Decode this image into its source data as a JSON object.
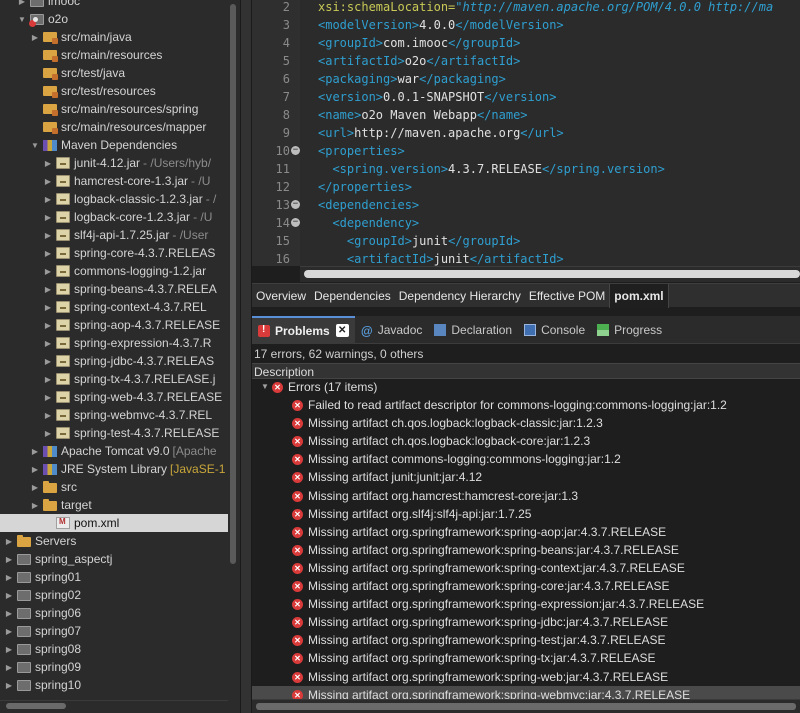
{
  "explorer": {
    "items": [
      {
        "label": "imooc",
        "icon": "project-icon",
        "twisty": "closed"
      },
      {
        "label": "o2o",
        "icon": "project-error-icon",
        "twisty": "open"
      },
      {
        "label": "src/main/java",
        "icon": "source-folder-icon",
        "twisty": "closed"
      },
      {
        "label": "src/main/resources",
        "icon": "source-folder-icon",
        "twisty": ""
      },
      {
        "label": "src/test/java",
        "icon": "source-folder-icon",
        "twisty": ""
      },
      {
        "label": "src/test/resources",
        "icon": "source-folder-icon",
        "twisty": ""
      },
      {
        "label": "src/main/resources/spring",
        "icon": "source-folder-icon",
        "twisty": ""
      },
      {
        "label": "src/main/resources/mapper",
        "icon": "source-folder-icon",
        "twisty": ""
      },
      {
        "label": "Maven Dependencies",
        "icon": "library-icon",
        "twisty": "open"
      },
      {
        "label": "junit-4.12.jar",
        "icon": "jar-icon",
        "twisty": "closed",
        "decoration": "- /Users/hyb/"
      },
      {
        "label": "hamcrest-core-1.3.jar",
        "icon": "jar-icon",
        "twisty": "closed",
        "decoration": "- /U"
      },
      {
        "label": "logback-classic-1.2.3.jar",
        "icon": "jar-icon",
        "twisty": "closed",
        "decoration": "- /"
      },
      {
        "label": "logback-core-1.2.3.jar",
        "icon": "jar-icon",
        "twisty": "closed",
        "decoration": "- /U"
      },
      {
        "label": "slf4j-api-1.7.25.jar",
        "icon": "jar-icon",
        "twisty": "closed",
        "decoration": "- /User"
      },
      {
        "label": "spring-core-4.3.7.RELEAS",
        "icon": "jar-icon",
        "twisty": "closed"
      },
      {
        "label": "commons-logging-1.2.jar",
        "icon": "jar-icon",
        "twisty": "closed"
      },
      {
        "label": "spring-beans-4.3.7.RELEA",
        "icon": "jar-icon",
        "twisty": "closed"
      },
      {
        "label": "spring-context-4.3.7.REL",
        "icon": "jar-icon",
        "twisty": "closed"
      },
      {
        "label": "spring-aop-4.3.7.RELEASE",
        "icon": "jar-icon",
        "twisty": "closed"
      },
      {
        "label": "spring-expression-4.3.7.R",
        "icon": "jar-icon",
        "twisty": "closed"
      },
      {
        "label": "spring-jdbc-4.3.7.RELEAS",
        "icon": "jar-icon",
        "twisty": "closed"
      },
      {
        "label": "spring-tx-4.3.7.RELEASE.j",
        "icon": "jar-icon",
        "twisty": "closed"
      },
      {
        "label": "spring-web-4.3.7.RELEASE",
        "icon": "jar-icon",
        "twisty": "closed"
      },
      {
        "label": "spring-webmvc-4.3.7.REL",
        "icon": "jar-icon",
        "twisty": "closed"
      },
      {
        "label": "spring-test-4.3.7.RELEASE",
        "icon": "jar-icon",
        "twisty": "closed"
      },
      {
        "label": "Apache Tomcat v9.0",
        "icon": "library-icon",
        "twisty": "closed",
        "decoration": "[Apache"
      },
      {
        "label": "JRE System Library",
        "icon": "library-icon",
        "twisty": "closed",
        "decoration": "[JavaSE-1"
      },
      {
        "label": "src",
        "icon": "folder-icon",
        "twisty": "closed"
      },
      {
        "label": "target",
        "icon": "folder-icon",
        "twisty": "closed"
      },
      {
        "label": "pom.xml",
        "icon": "xml-file-icon",
        "twisty": "",
        "selected": true
      },
      {
        "label": "Servers",
        "icon": "servers-folder-icon",
        "twisty": "closed"
      },
      {
        "label": "spring_aspectj",
        "icon": "project-icon",
        "twisty": "closed"
      },
      {
        "label": "spring01",
        "icon": "project-icon",
        "twisty": "closed"
      },
      {
        "label": "spring02",
        "icon": "project-icon",
        "twisty": "closed"
      },
      {
        "label": "spring06",
        "icon": "project-icon",
        "twisty": "closed"
      },
      {
        "label": "spring07",
        "icon": "project-icon",
        "twisty": "closed"
      },
      {
        "label": "spring08",
        "icon": "project-icon",
        "twisty": "closed"
      },
      {
        "label": "spring09",
        "icon": "project-icon",
        "twisty": "closed"
      },
      {
        "label": "spring10",
        "icon": "project-icon",
        "twisty": "closed"
      }
    ]
  },
  "editor": {
    "lines": [
      {
        "n": "2",
        "text": "xsi:schemaLocation=\"http://maven.apache.org/POM/4.0.0 http://ma",
        "fold": ""
      },
      {
        "n": "3",
        "text": "<modelVersion>4.0.0</modelVersion>",
        "fold": ""
      },
      {
        "n": "4",
        "text": "<groupId>com.imooc</groupId>",
        "fold": ""
      },
      {
        "n": "5",
        "text": "<artifactId>o2o</artifactId>",
        "fold": ""
      },
      {
        "n": "6",
        "text": "<packaging>war</packaging>",
        "fold": ""
      },
      {
        "n": "7",
        "text": "<version>0.0.1-SNAPSHOT</version>",
        "fold": ""
      },
      {
        "n": "8",
        "text": "<name>o2o Maven Webapp</name>",
        "fold": ""
      },
      {
        "n": "9",
        "text": "<url>http://maven.apache.org</url>",
        "fold": ""
      },
      {
        "n": "10",
        "text": "<properties>",
        "fold": "−"
      },
      {
        "n": "11",
        "text": "  <spring.version>4.3.7.RELEASE</spring.version>",
        "fold": ""
      },
      {
        "n": "12",
        "text": "</properties>",
        "fold": ""
      },
      {
        "n": "13",
        "text": "<dependencies>",
        "fold": "−"
      },
      {
        "n": "14",
        "text": "  <dependency>",
        "fold": "−"
      },
      {
        "n": "15",
        "text": "    <groupId>junit</groupId>",
        "fold": ""
      },
      {
        "n": "16",
        "text": "    <artifactId>junit</artifactId>",
        "fold": ""
      }
    ],
    "tabs": [
      "Overview",
      "Dependencies",
      "Dependency Hierarchy",
      "Effective POM",
      "pom.xml"
    ],
    "active_tab": "pom.xml"
  },
  "views": {
    "tabs": [
      {
        "label": "Problems",
        "icon": "problems-icon",
        "active": true
      },
      {
        "label": "Javadoc",
        "icon": "javadoc-icon",
        "active": false
      },
      {
        "label": "Declaration",
        "icon": "declaration-icon",
        "active": false
      },
      {
        "label": "Console",
        "icon": "console-icon",
        "active": false
      },
      {
        "label": "Progress",
        "icon": "progress-icon",
        "active": false
      }
    ],
    "close_glyph": "✕"
  },
  "problems": {
    "summary": "17 errors, 62 warnings, 0 others",
    "column_header": "Description",
    "group_label": "Errors (17 items)",
    "errors": [
      "Failed to read artifact descriptor for commons-logging:commons-logging:jar:1.2",
      "Missing artifact ch.qos.logback:logback-classic:jar:1.2.3",
      "Missing artifact ch.qos.logback:logback-core:jar:1.2.3",
      "Missing artifact commons-logging:commons-logging:jar:1.2",
      "Missing artifact junit:junit:jar:4.12",
      "Missing artifact org.hamcrest:hamcrest-core:jar:1.3",
      "Missing artifact org.slf4j:slf4j-api:jar:1.7.25",
      "Missing artifact org.springframework:spring-aop:jar:4.3.7.RELEASE",
      "Missing artifact org.springframework:spring-beans:jar:4.3.7.RELEASE",
      "Missing artifact org.springframework:spring-context:jar:4.3.7.RELEASE",
      "Missing artifact org.springframework:spring-core:jar:4.3.7.RELEASE",
      "Missing artifact org.springframework:spring-expression:jar:4.3.7.RELEASE",
      "Missing artifact org.springframework:spring-jdbc:jar:4.3.7.RELEASE",
      "Missing artifact org.springframework:spring-test:jar:4.3.7.RELEASE",
      "Missing artifact org.springframework:spring-tx:jar:4.3.7.RELEASE",
      "Missing artifact org.springframework:spring-web:jar:4.3.7.RELEASE",
      "Missing artifact org.springframework:spring-webmvc:jar:4.3.7.RELEASE"
    ],
    "selected_index": 16
  },
  "colors": {
    "tag": "#2f9fd0",
    "attr": "#c9c957",
    "error": "#d93a3a",
    "folder": "#d9a441"
  }
}
